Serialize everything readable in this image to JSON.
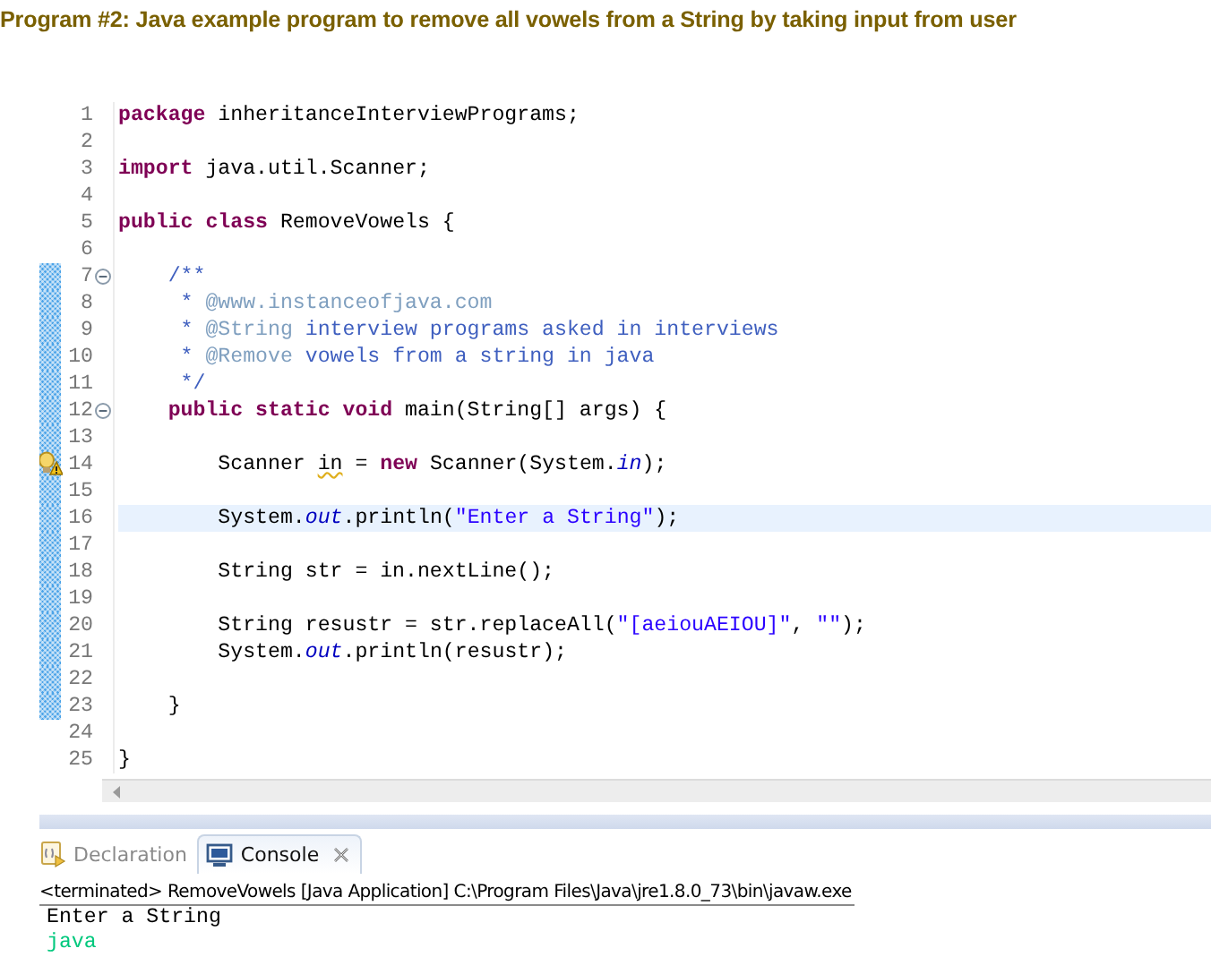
{
  "title": "Program #2: Java example program to remove all vowels from a String by taking input from user",
  "editor": {
    "lines": [
      {
        "number": "1",
        "changed": false,
        "foldable": false,
        "warning": false,
        "selected": false,
        "tokens": [
          {
            "kind": "keyword",
            "text": "package"
          },
          {
            "kind": "plain",
            "text": " inheritanceInterviewPrograms;"
          }
        ]
      },
      {
        "number": "2",
        "changed": false,
        "foldable": false,
        "warning": false,
        "selected": false
      },
      {
        "number": "3",
        "changed": false,
        "foldable": false,
        "warning": false,
        "selected": false,
        "tokens": [
          {
            "kind": "keyword",
            "text": "import"
          },
          {
            "kind": "plain",
            "text": " java.util.Scanner;"
          }
        ]
      },
      {
        "number": "4",
        "changed": false,
        "foldable": false,
        "warning": false,
        "selected": false
      },
      {
        "number": "5",
        "changed": false,
        "foldable": false,
        "warning": false,
        "selected": false,
        "tokens": [
          {
            "kind": "keyword",
            "text": "public class"
          },
          {
            "kind": "plain",
            "text": " RemoveVowels {"
          }
        ]
      },
      {
        "number": "6",
        "changed": false,
        "foldable": false,
        "warning": false,
        "selected": false
      },
      {
        "number": "7",
        "changed": true,
        "foldable": true,
        "warning": false,
        "selected": false,
        "tokens": [
          {
            "kind": "doc",
            "text": "    /**"
          }
        ]
      },
      {
        "number": "8",
        "changed": true,
        "foldable": false,
        "warning": false,
        "selected": false,
        "tokens": [
          {
            "kind": "doc",
            "text": "     * "
          },
          {
            "kind": "doctag",
            "text": "@www.instanceofjava.com"
          }
        ]
      },
      {
        "number": "9",
        "changed": true,
        "foldable": false,
        "warning": false,
        "selected": false,
        "tokens": [
          {
            "kind": "doc",
            "text": "     * "
          },
          {
            "kind": "doctag",
            "text": "@String"
          },
          {
            "kind": "doc",
            "text": " interview programs asked in interviews"
          }
        ]
      },
      {
        "number": "10",
        "changed": true,
        "foldable": false,
        "warning": false,
        "selected": false,
        "tokens": [
          {
            "kind": "doc",
            "text": "     * "
          },
          {
            "kind": "doctag",
            "text": "@Remove"
          },
          {
            "kind": "doc",
            "text": " vowels from a string in java"
          }
        ]
      },
      {
        "number": "11",
        "changed": true,
        "foldable": false,
        "warning": false,
        "selected": false,
        "tokens": [
          {
            "kind": "doc",
            "text": "     */"
          }
        ]
      },
      {
        "number": "12",
        "changed": true,
        "foldable": true,
        "warning": false,
        "selected": false,
        "tokens": [
          {
            "kind": "keyword",
            "text": "    public static void"
          },
          {
            "kind": "plain",
            "text": " main(String[] args) {"
          }
        ]
      },
      {
        "number": "13",
        "changed": true,
        "foldable": false,
        "warning": false,
        "selected": false
      },
      {
        "number": "14",
        "changed": true,
        "foldable": false,
        "warning": true,
        "selected": false,
        "tokens": [
          {
            "kind": "plain",
            "text": "        Scanner "
          },
          {
            "kind": "warned",
            "text": "in"
          },
          {
            "kind": "plain",
            "text": " = "
          },
          {
            "kind": "keyword",
            "text": "new"
          },
          {
            "kind": "plain",
            "text": " Scanner(System."
          },
          {
            "kind": "field",
            "text": "in"
          },
          {
            "kind": "plain",
            "text": ");"
          }
        ]
      },
      {
        "number": "15",
        "changed": true,
        "foldable": false,
        "warning": false,
        "selected": false
      },
      {
        "number": "16",
        "changed": true,
        "foldable": false,
        "warning": false,
        "selected": true,
        "tokens": [
          {
            "kind": "plain",
            "text": "        System."
          },
          {
            "kind": "field",
            "text": "out"
          },
          {
            "kind": "plain",
            "text": ".println("
          },
          {
            "kind": "string",
            "text": "\"Enter a String\""
          },
          {
            "kind": "plain",
            "text": ");"
          }
        ]
      },
      {
        "number": "17",
        "changed": true,
        "foldable": false,
        "warning": false,
        "selected": false
      },
      {
        "number": "18",
        "changed": true,
        "foldable": false,
        "warning": false,
        "selected": false,
        "tokens": [
          {
            "kind": "plain",
            "text": "        String str = in.nextLine();"
          }
        ]
      },
      {
        "number": "19",
        "changed": true,
        "foldable": false,
        "warning": false,
        "selected": false
      },
      {
        "number": "20",
        "changed": true,
        "foldable": false,
        "warning": false,
        "selected": false,
        "tokens": [
          {
            "kind": "plain",
            "text": "        String resustr = str.replaceAll("
          },
          {
            "kind": "string",
            "text": "\"[aeiouAEIOU]\""
          },
          {
            "kind": "plain",
            "text": ", "
          },
          {
            "kind": "string",
            "text": "\"\""
          },
          {
            "kind": "plain",
            "text": ");"
          }
        ]
      },
      {
        "number": "21",
        "changed": true,
        "foldable": false,
        "warning": false,
        "selected": false,
        "tokens": [
          {
            "kind": "plain",
            "text": "        System."
          },
          {
            "kind": "field",
            "text": "out"
          },
          {
            "kind": "plain",
            "text": ".println(resustr);"
          }
        ]
      },
      {
        "number": "22",
        "changed": true,
        "foldable": false,
        "warning": false,
        "selected": false
      },
      {
        "number": "23",
        "changed": true,
        "foldable": false,
        "warning": false,
        "selected": false,
        "tokens": [
          {
            "kind": "plain",
            "text": "    }"
          }
        ]
      },
      {
        "number": "24",
        "changed": false,
        "foldable": false,
        "warning": false,
        "selected": false
      },
      {
        "number": "25",
        "changed": false,
        "foldable": false,
        "warning": false,
        "selected": false,
        "tokens": [
          {
            "kind": "plain",
            "text": "}"
          }
        ]
      }
    ]
  },
  "console": {
    "tabs": [
      {
        "label": "Declaration",
        "selected": false,
        "closable": false
      },
      {
        "label": "Console",
        "selected": true,
        "closable": true
      }
    ],
    "header": "<terminated> RemoveVowels [Java Application] C:\\Program Files\\Java\\jre1.8.0_73\\bin\\javaw.exe",
    "output": [
      {
        "kind": "stdout",
        "text": "Enter a String"
      },
      {
        "kind": "stdin",
        "text": "java"
      }
    ]
  }
}
